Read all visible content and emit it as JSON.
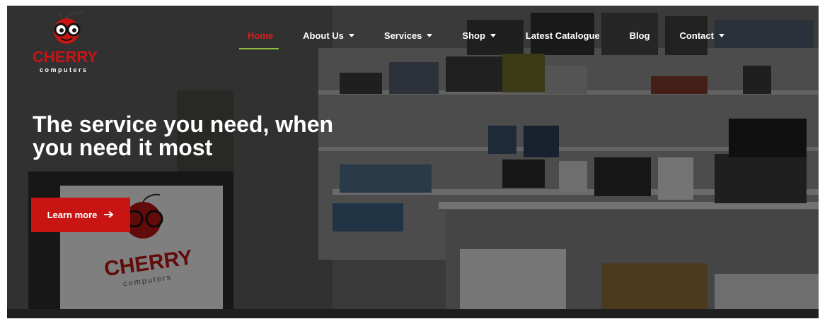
{
  "brand": {
    "logo_wordmark": "CHERRY",
    "logo_subtext": "computers",
    "accent_red": "#c91414",
    "nav_active_color": "#e11b1b",
    "nav_underline_color": "#8dbb3a"
  },
  "nav": {
    "items": [
      {
        "label": "Home",
        "active": true,
        "has_dropdown": false
      },
      {
        "label": "About Us",
        "active": false,
        "has_dropdown": true
      },
      {
        "label": "Services",
        "active": false,
        "has_dropdown": true
      },
      {
        "label": "Shop",
        "active": false,
        "has_dropdown": true
      },
      {
        "label": "Latest Catalogue",
        "active": false,
        "has_dropdown": false
      },
      {
        "label": "Blog",
        "active": false,
        "has_dropdown": false
      },
      {
        "label": "Contact",
        "active": false,
        "has_dropdown": true
      }
    ]
  },
  "hero": {
    "headline_line1": "The service you need, when",
    "headline_line2": "you need it most",
    "cta_label": "Learn more",
    "cta_icon": "arrow-right-icon",
    "counter_sign_wordmark": "CHERRY",
    "counter_sign_subtext": "computers"
  }
}
